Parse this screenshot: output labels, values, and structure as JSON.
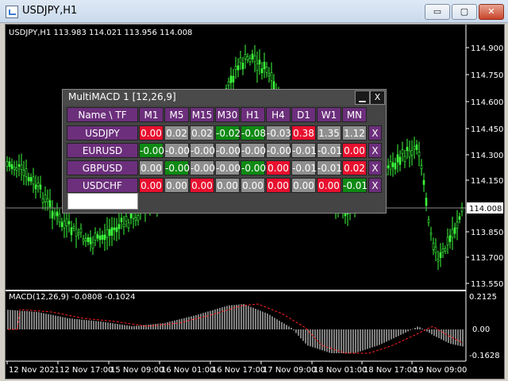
{
  "window": {
    "title": "USDJPY,H1",
    "minimize": "▭",
    "restore": "▢",
    "close": "✕"
  },
  "chart": {
    "info": "USDJPY,H1  113.983 114.021 113.956 114.008",
    "price_labels": [
      "114.900",
      "114.750",
      "114.600",
      "114.450",
      "114.300",
      "114.150",
      "114.008",
      "113.850",
      "113.700",
      "113.550"
    ],
    "current_price": "114.008",
    "date_labels": [
      "12 Nov 2021",
      "12 Nov 17:00",
      "15 Nov 09:00",
      "16 Nov 01:00",
      "16 Nov 17:00",
      "17 Nov 09:00",
      "18 Nov 01:00",
      "18 Nov 17:00",
      "19 Nov 09:00"
    ],
    "candle_color": "#3cff3c"
  },
  "macd": {
    "info": "MACD(12,26,9) -0.0808 -0.1024",
    "scale_labels": [
      "0.2125",
      "0.00",
      "-0.1628"
    ],
    "signal_color": "#ff2020"
  },
  "panel": {
    "title": "MultiMACD 1 [12,26,9]",
    "min_label": "▁",
    "close_label": "X",
    "header_name": "Name \\ TF",
    "timeframes": [
      "M1",
      "M5",
      "M15",
      "M30",
      "H1",
      "H4",
      "D1",
      "W1",
      "MN"
    ],
    "rows": [
      {
        "symbol": "USDJPY",
        "values": [
          "0.00",
          "0.02",
          "0.02",
          "-0.02",
          "-0.08",
          "-0.03",
          "0.38",
          "1.35",
          "1.12"
        ],
        "colors": [
          "red",
          "gray",
          "gray",
          "green",
          "green",
          "gray",
          "red",
          "gray",
          "gray"
        ],
        "remove": "X"
      },
      {
        "symbol": "EURUSD",
        "values": [
          "-0.00",
          "-0.00",
          "-0.00",
          "-0.00",
          "-0.00",
          "-0.00",
          "-0.01",
          "-0.01",
          "0.00"
        ],
        "colors": [
          "green",
          "gray",
          "gray",
          "gray",
          "gray",
          "gray",
          "gray",
          "gray",
          "red"
        ],
        "remove": "X"
      },
      {
        "symbol": "GBPUSD",
        "values": [
          "0.00",
          "-0.00",
          "-0.00",
          "-0.00",
          "-0.00",
          "0.00",
          "-0.01",
          "-0.01",
          "0.02"
        ],
        "colors": [
          "gray",
          "green",
          "gray",
          "gray",
          "green",
          "red",
          "gray",
          "gray",
          "red"
        ],
        "remove": "X"
      },
      {
        "symbol": "USDCHF",
        "values": [
          "0.00",
          "0.00",
          "0.00",
          "0.00",
          "0.00",
          "0.00",
          "0.00",
          "0.00",
          "-0.01"
        ],
        "colors": [
          "red",
          "gray",
          "red",
          "gray",
          "gray",
          "red",
          "gray",
          "red",
          "green"
        ],
        "remove": "X"
      }
    ],
    "input_value": ""
  }
}
